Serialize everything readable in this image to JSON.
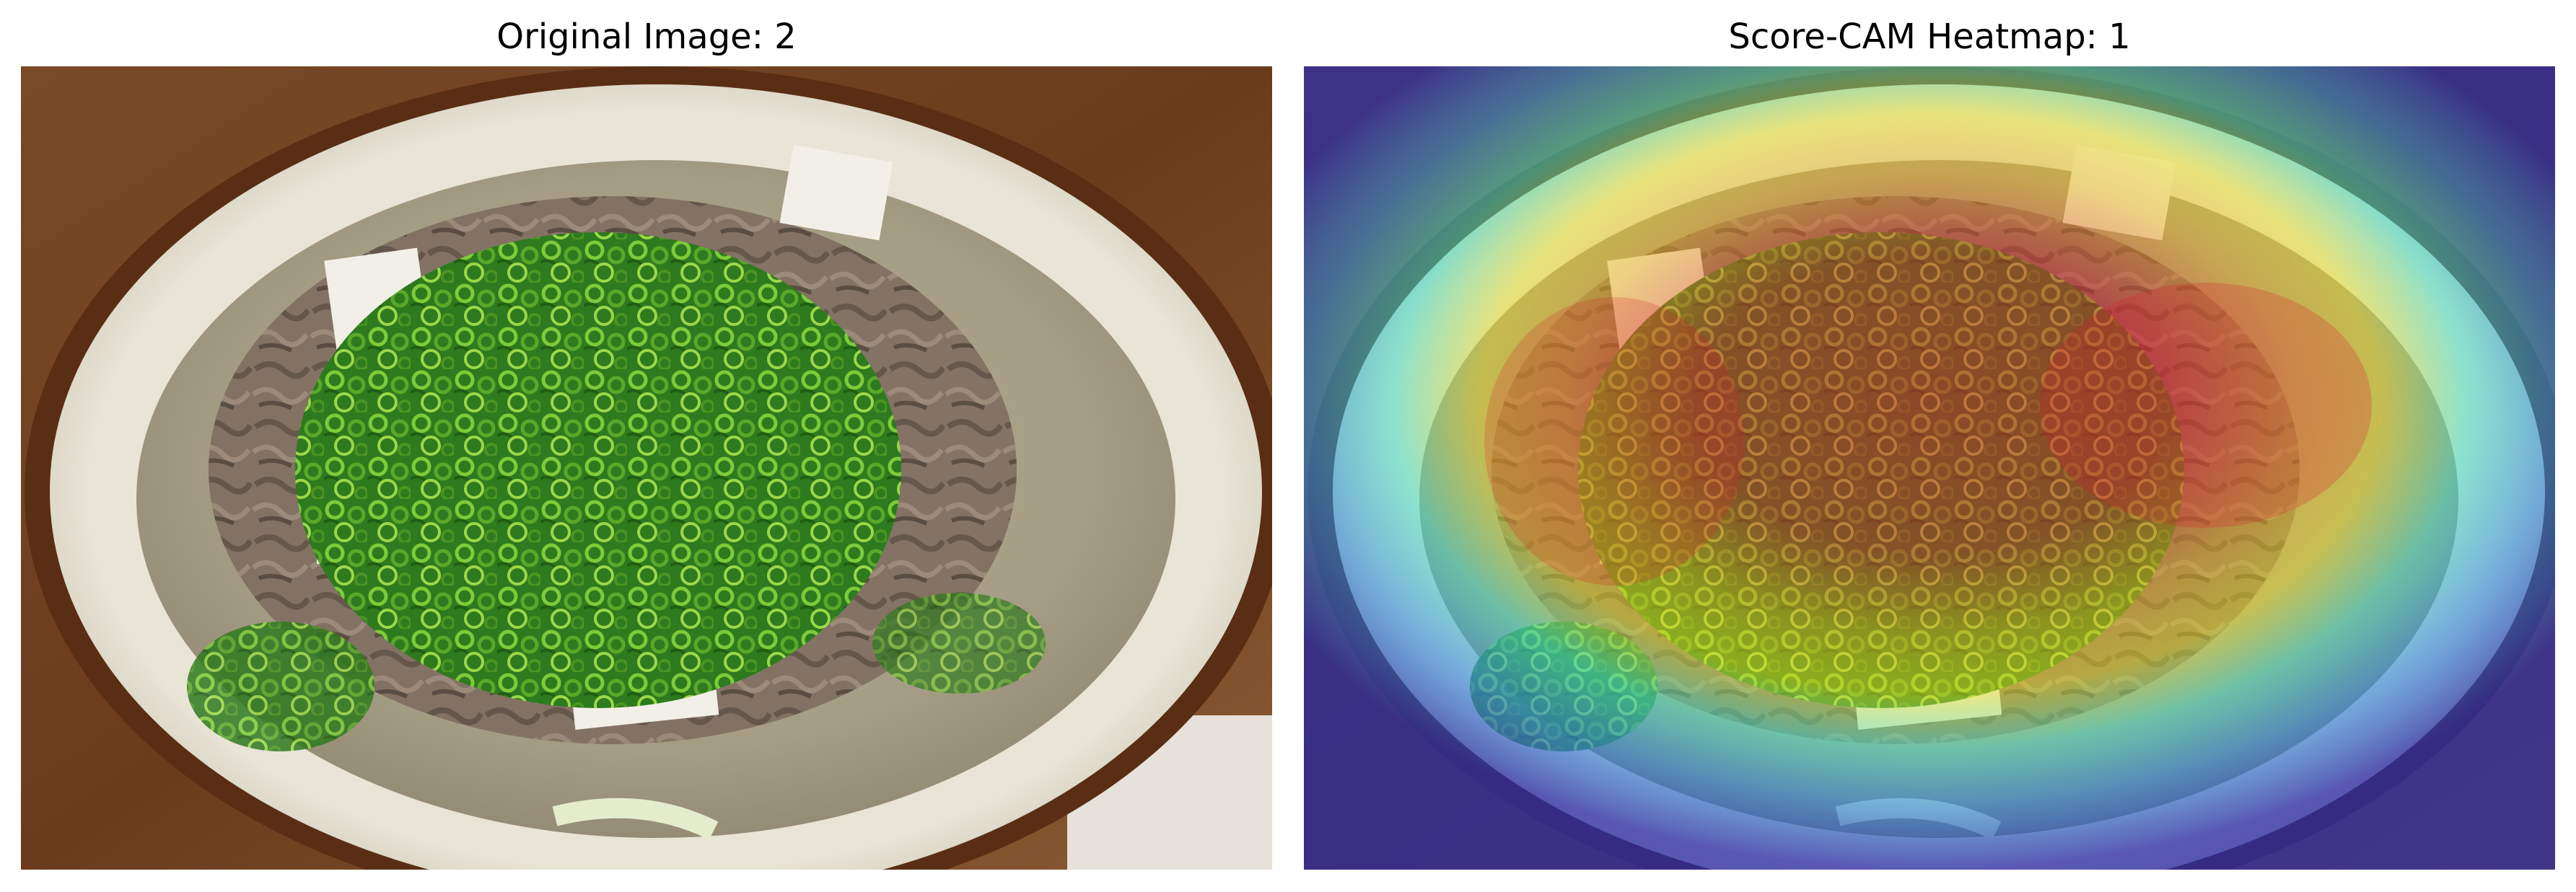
{
  "panels": [
    {
      "title": "Original Image: 2"
    },
    {
      "title": "Score-CAM Heatmap: 1"
    }
  ],
  "colors": {
    "background": "#ffffff",
    "title_text": "#000000",
    "heatmap_hot": "#d8202e",
    "heatmap_warm": "#e8e020",
    "heatmap_mid": "#30d8e0",
    "heatmap_cold": "#2a2aa8"
  }
}
